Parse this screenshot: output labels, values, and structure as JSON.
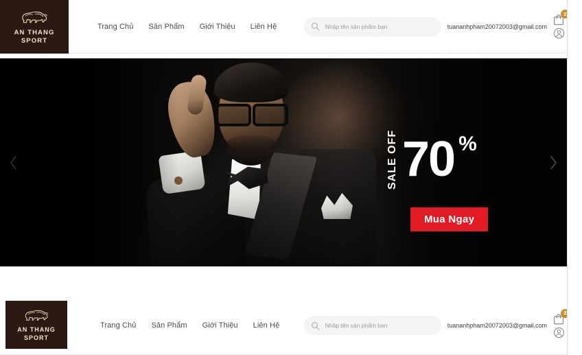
{
  "brand": {
    "logo_line1": "AN THANG",
    "logo_line2": "SPORT",
    "logo_icon": "bison-icon",
    "logo_bg": "#2b1a14",
    "logo_fg": "#f4e3c8"
  },
  "nav": {
    "items": [
      {
        "label": "Trang Chủ",
        "name": "nav-link-home"
      },
      {
        "label": "Sản Phẩm",
        "name": "nav-link-products"
      },
      {
        "label": "Giới Thiệu",
        "name": "nav-link-about"
      },
      {
        "label": "Liên Hệ",
        "name": "nav-link-contact"
      }
    ]
  },
  "search": {
    "placeholder": "Nhập tên sản phẩm bạn",
    "value": "",
    "icon": "search-icon"
  },
  "account": {
    "email": "tuananhpham20072003@gmail.com",
    "account_icon": "user-circle-icon"
  },
  "cart": {
    "icon": "shopping-bag-icon",
    "badge_count": "2",
    "badge_color": "#c8902f"
  },
  "hero": {
    "prev_label": "‹",
    "next_label": "›",
    "prev_icon": "chevron-left-icon",
    "next_icon": "chevron-right-icon",
    "background_color": "#050505",
    "promo": {
      "sale_off_text": "SALE OFF",
      "discount_number": "70",
      "percent_symbol": "%",
      "cta_label": "Mua Ngay",
      "cta_color": "#e01b24",
      "text_color": "#ffffff"
    },
    "image_alt": "man-in-tuxedo-with-glasses"
  }
}
